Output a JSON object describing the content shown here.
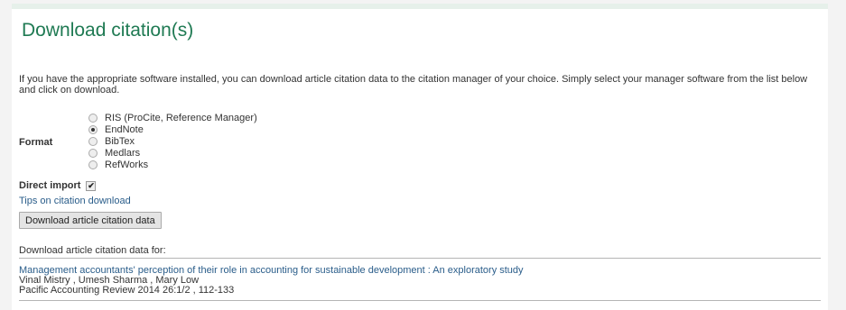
{
  "title": "Download citation(s)",
  "intro": "If you have the appropriate software installed, you can download article citation data to the citation manager of your choice. Simply select your manager software from the list below and click on download.",
  "format": {
    "label": "Format",
    "options": [
      "RIS (ProCite, Reference Manager)",
      "EndNote",
      "BibTex",
      "Medlars",
      "RefWorks"
    ],
    "selected": "EndNote"
  },
  "direct_import": {
    "label": "Direct import",
    "checked": true
  },
  "tips_link": "Tips on citation download",
  "download_button": "Download article citation data",
  "download_for_label": "Download article citation data for:",
  "citation": {
    "title": "Management accountants' perception of their role in accounting for sustainable development : An exploratory study",
    "authors": "Vinal Mistry , Umesh Sharma , Mary Low",
    "source": "Pacific Accounting Review 2014 26:1/2 , 112-133"
  }
}
